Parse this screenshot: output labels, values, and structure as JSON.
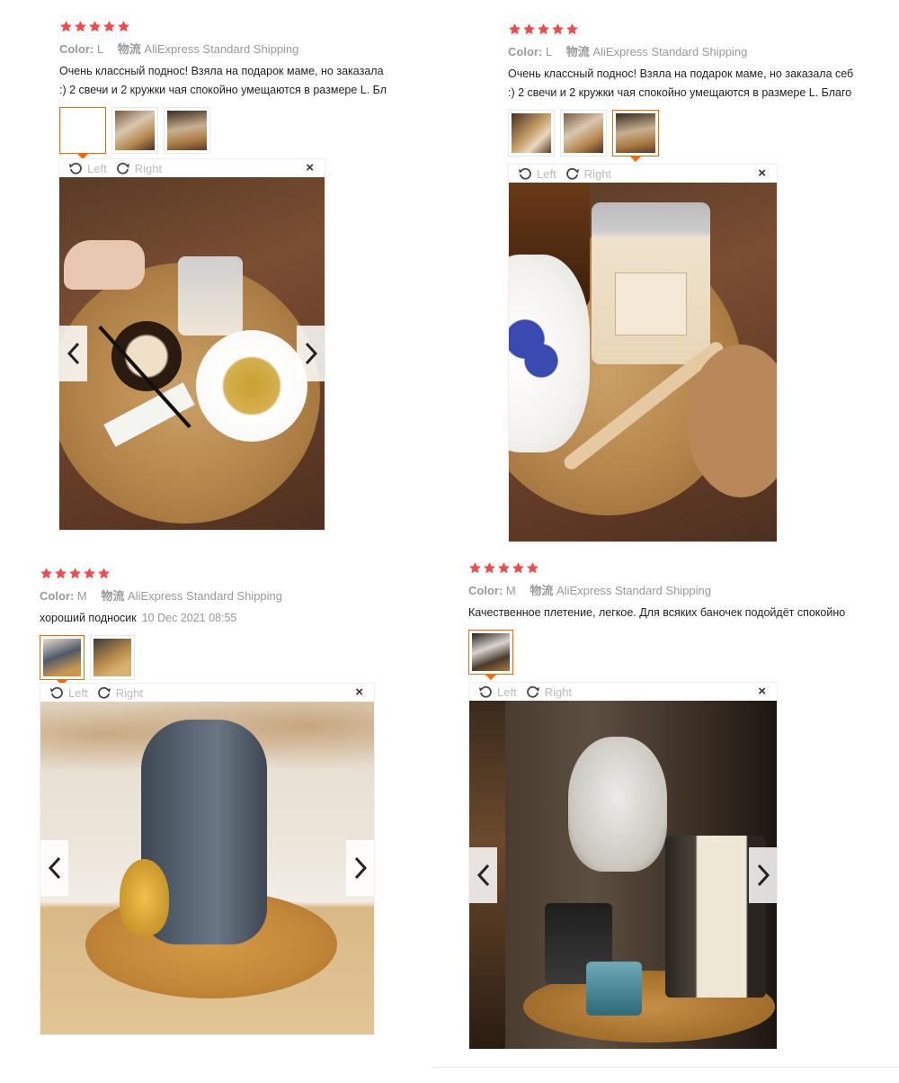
{
  "reviews": [
    {
      "rating": 5,
      "color_label": "Color:",
      "color_value": "L",
      "ship_label": "物流",
      "ship_value": "AliExpress Standard Shipping",
      "text": "Очень классный поднос! Взяла на подарок маме, но заказала",
      "text2": ":) 2 свечи и 2 кружки чая спокойно умещаются в размере L. Бл",
      "thumbs": 3,
      "active_thumb": 0
    },
    {
      "rating": 5,
      "color_label": "Color:",
      "color_value": "L",
      "ship_label": "物流",
      "ship_value": "AliExpress Standard Shipping",
      "text": "Очень классный поднос! Взяла на подарок маме, но заказала себ",
      "text2": ":) 2 свечи и 2 кружки чая спокойно умещаются в размере L. Благо",
      "thumbs": 3,
      "active_thumb": 2
    },
    {
      "rating": 5,
      "color_label": "Color:",
      "color_value": "M",
      "ship_label": "物流",
      "ship_value": "AliExpress Standard Shipping",
      "text": "хороший подносик",
      "date": "10 Dec 2021 08:55",
      "thumbs": 2,
      "active_thumb": 0
    },
    {
      "rating": 5,
      "color_label": "Color:",
      "color_value": "M",
      "ship_label": "物流",
      "ship_value": "AliExpress Standard Shipping",
      "text": "Качественное плетение, легкое. Для всяких баночек подойдёт спокойно",
      "thumbs": 1,
      "active_thumb": 0
    }
  ],
  "viewer": {
    "rotate_left": "Left",
    "rotate_right": "Right",
    "close": "×"
  },
  "colors": {
    "star": "#f5484a",
    "accent": "#ff6600"
  }
}
